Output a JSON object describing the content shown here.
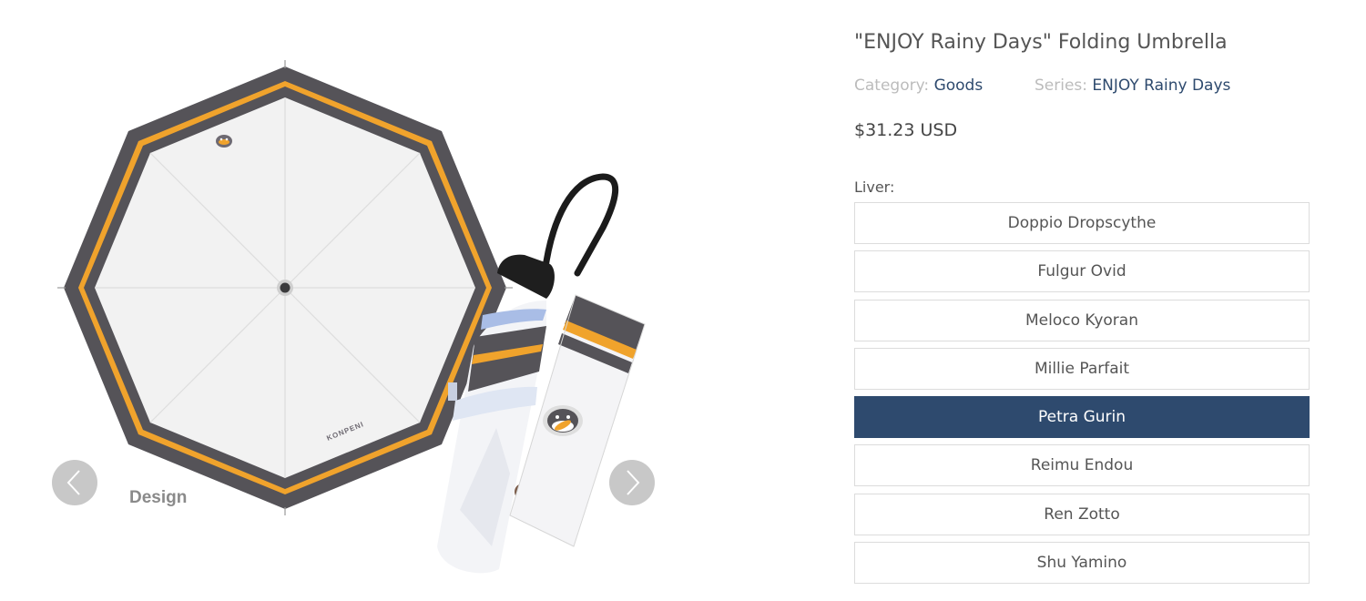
{
  "gallery": {
    "image_caption": "Design",
    "umbrella_logo_text": "KONPENI",
    "colors": {
      "frame": "#555358",
      "stripe": "#f0a32c",
      "canopy": "#f2f2f2"
    }
  },
  "product": {
    "title": "\"ENJOY Rainy Days\" Folding Umbrella",
    "category_label": "Category:",
    "category_value": "Goods",
    "series_label": "Series:",
    "series_value": "ENJOY Rainy Days",
    "price": "$31.23 USD"
  },
  "liver": {
    "label": "Liver:",
    "options": [
      {
        "name": "Doppio Dropscythe",
        "selected": false
      },
      {
        "name": "Fulgur Ovid",
        "selected": false
      },
      {
        "name": "Meloco Kyoran",
        "selected": false
      },
      {
        "name": "Millie Parfait",
        "selected": false
      },
      {
        "name": "Petra Gurin",
        "selected": true
      },
      {
        "name": "Reimu Endou",
        "selected": false
      },
      {
        "name": "Ren Zotto",
        "selected": false
      },
      {
        "name": "Shu Yamino",
        "selected": false
      }
    ]
  },
  "theme": {
    "accent": "#2e4a6e"
  }
}
